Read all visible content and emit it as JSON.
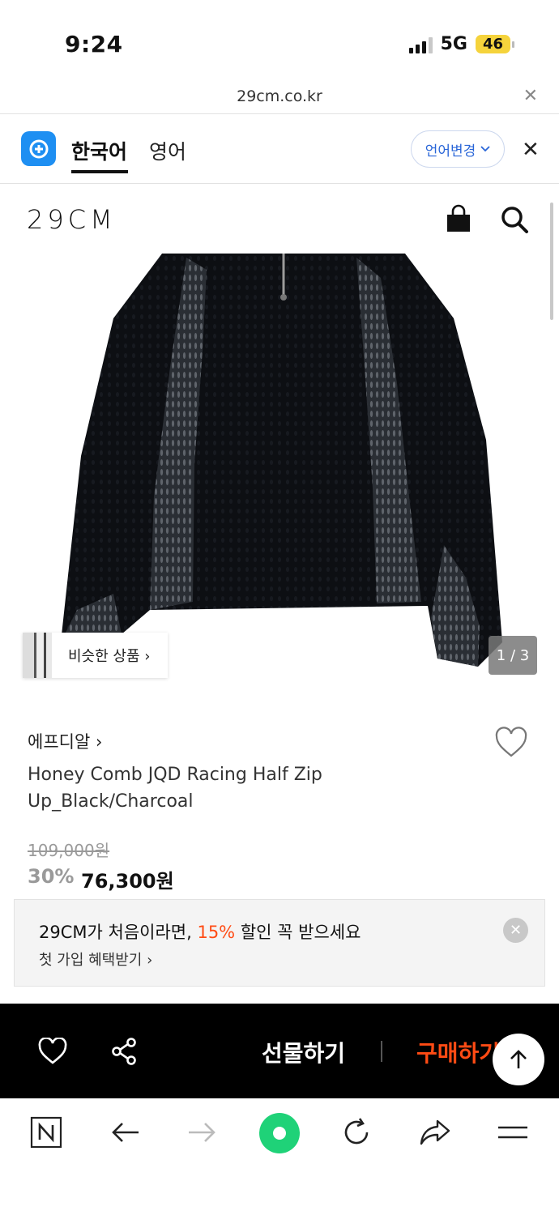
{
  "status_bar": {
    "time": "9:24",
    "network": "5G",
    "battery": "46"
  },
  "browser": {
    "url": "29cm.co.kr"
  },
  "translate_bar": {
    "tab_korean": "한국어",
    "tab_english": "영어",
    "change_language": "언어변경"
  },
  "site": {
    "logo": "29CM"
  },
  "gallery": {
    "similar_label": "비슷한 상품 ›",
    "counter": "1 / 3"
  },
  "product": {
    "brand": "에프디알 ›",
    "title": "Honey Comb JQD Racing Half Zip Up_Black/Charcoal",
    "original_price": "109,000원",
    "discount": "30%",
    "sale_price": "76,300원"
  },
  "promo": {
    "line1_prefix": "29CM가 처음이라면, ",
    "line1_highlight": "15%",
    "line1_suffix": " 할인 꼭 받으세요",
    "line2": "첫 가입 혜택받기 ›"
  },
  "buy_bar": {
    "gift_label": "선물하기",
    "buy_label": "구매하기"
  },
  "colors": {
    "accent": "#ff4b14",
    "translate_blue": "#1e8ff2",
    "link_blue": "#2a66d8"
  }
}
